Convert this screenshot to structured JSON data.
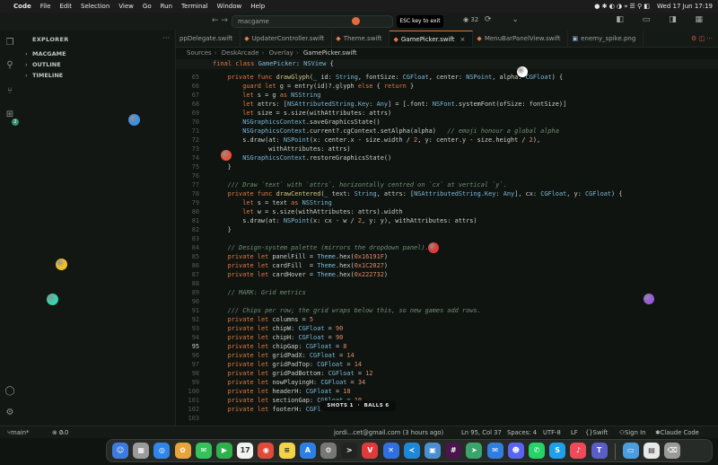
{
  "menubar": {
    "app": "Code",
    "items": [
      "File",
      "Edit",
      "Selection",
      "View",
      "Go",
      "Run",
      "Terminal",
      "Window",
      "Help"
    ],
    "clock": "Wed 17 Jun  17:19"
  },
  "titlebar": {
    "search": "macgame",
    "esc_hint": "ESC key to exit",
    "count": "32"
  },
  "sidebar": {
    "title": "EXPLORER",
    "sections": [
      "MACGAME",
      "OUTLINE",
      "TIMELINE"
    ]
  },
  "activity": {
    "badge": "2"
  },
  "tabs": [
    {
      "label": "ppDelegate.swift",
      "kind": "swift",
      "active": false
    },
    {
      "label": "UpdaterController.swift",
      "kind": "swift",
      "active": false
    },
    {
      "label": "Theme.swift",
      "kind": "swift",
      "active": false
    },
    {
      "label": "GamePicker.swift",
      "kind": "swift",
      "active": true
    },
    {
      "label": "MenuBarPanelView.swift",
      "kind": "swift",
      "active": false
    },
    {
      "label": "enemy_spike.png",
      "kind": "png",
      "active": false
    }
  ],
  "breadcrumb": [
    "Sources",
    "DeskArcade",
    "Overlay",
    "GamePicker.swift"
  ],
  "sticky": {
    "num": "18",
    "text": "final class GamePicker: NSView {"
  },
  "code_lines": [
    {
      "n": "65",
      "html": "    <span class='kw'>private func</span> <span class='fn'>drawGlyph</span>(_ id: <span class='ty'>String</span>, fontSize: <span class='ty'>CGFloat</span>, center: <span class='ty'>NSPoint</span>, alpha: <span class='ty'>CGFloat</span>) {"
    },
    {
      "n": "66",
      "html": "        <span class='kw'>guard let</span> g = entry(id)?.glyph <span class='kw'>else</span> { <span class='kw'>return</span> }"
    },
    {
      "n": "67",
      "html": "        <span class='kw'>let</span> s = g <span class='kw'>as</span> <span class='ty'>NSString</span>"
    },
    {
      "n": "68",
      "html": "        <span class='kw'>let</span> attrs: [<span class='ty'>NSAttributedString.Key</span>: <span class='ty'>Any</span>] = [.font: <span class='ty'>NSFont</span>.systemFont(ofSize: fontSize)]"
    },
    {
      "n": "69",
      "html": "        <span class='kw'>let</span> size = s.size(withAttributes: attrs)"
    },
    {
      "n": "70",
      "html": "        <span class='ty'>NSGraphicsContext</span>.saveGraphicsState()"
    },
    {
      "n": "71",
      "html": "        <span class='ty'>NSGraphicsContext</span>.current?.cgContext.setAlpha(alpha)   <span class='cm'>// emoji honour a global alpha</span>"
    },
    {
      "n": "72",
      "html": "        s.draw(at: <span class='ty'>NSPoint</span>(x: center.x - size.width / <span class='nm'>2</span>, y: center.y - size.height / <span class='nm'>2</span>),"
    },
    {
      "n": "73",
      "html": "               withAttributes: attrs)"
    },
    {
      "n": "74",
      "html": "        <span class='ty'>NSGraphicsContext</span>.restoreGraphicsState()"
    },
    {
      "n": "75",
      "html": "    }"
    },
    {
      "n": "76",
      "html": ""
    },
    {
      "n": "77",
      "html": "    <span class='cm'>/// Draw `text` with `attrs`, horizontally centred on `cx` at vertical `y`.</span>"
    },
    {
      "n": "78",
      "html": "    <span class='kw'>private func</span> <span class='fn'>drawCentered</span>(_ text: <span class='ty'>String</span>, attrs: [<span class='ty'>NSAttributedString.Key</span>: <span class='ty'>Any</span>], cx: <span class='ty'>CGFloat</span>, y: <span class='ty'>CGFloat</span>) {"
    },
    {
      "n": "79",
      "html": "        <span class='kw'>let</span> s = text <span class='kw'>as</span> <span class='ty'>NSString</span>"
    },
    {
      "n": "80",
      "html": "        <span class='kw'>let</span> w = s.size(withAttributes: attrs).width"
    },
    {
      "n": "81",
      "html": "        s.draw(at: <span class='ty'>NSPoint</span>(x: cx - w / <span class='nm'>2</span>, y: y), withAttributes: attrs)"
    },
    {
      "n": "82",
      "html": "    }"
    },
    {
      "n": "83",
      "html": ""
    },
    {
      "n": "84",
      "html": "    <span class='cm'>// Design-system palette (mirrors the dropdown panel).</span>"
    },
    {
      "n": "85",
      "html": "    <span class='kw'>private let</span> panelFill = <span class='ty'>Theme</span>.hex(<span class='nm'>0x16191F</span>)"
    },
    {
      "n": "86",
      "html": "    <span class='kw'>private let</span> cardFill  = <span class='ty'>Theme</span>.hex(<span class='nm'>0x1C2027</span>)"
    },
    {
      "n": "87",
      "html": "    <span class='kw'>private let</span> cardHover = <span class='ty'>Theme</span>.hex(<span class='nm'>0x222732</span>)"
    },
    {
      "n": "88",
      "html": ""
    },
    {
      "n": "89",
      "html": "    <span class='cm'>// MARK: Grid metrics</span>"
    },
    {
      "n": "90",
      "html": ""
    },
    {
      "n": "91",
      "html": "    <span class='cm'>/// Chips per row; the grid wraps below this, so new games add rows.</span>"
    },
    {
      "n": "92",
      "html": "    <span class='kw'>private let</span> columns = <span class='nm'>5</span>"
    },
    {
      "n": "93",
      "html": "    <span class='kw'>private let</span> chipW: <span class='ty'>CGFloat</span> = <span class='nm'>90</span>"
    },
    {
      "n": "94",
      "html": "    <span class='kw'>private let</span> chipH: <span class='ty'>CGFloat</span> = <span class='nm'>90</span>"
    },
    {
      "n": "95",
      "html": "    <span class='kw'>private let</span> chipGap: <span class='ty'>CGFloat</span> = <span class='nm'>8</span>",
      "cur": true
    },
    {
      "n": "96",
      "html": "    <span class='kw'>private let</span> gridPadX: <span class='ty'>CGFloat</span> = <span class='nm'>14</span>"
    },
    {
      "n": "97",
      "html": "    <span class='kw'>private let</span> gridPadTop: <span class='ty'>CGFloat</span> = <span class='nm'>14</span>"
    },
    {
      "n": "98",
      "html": "    <span class='kw'>private let</span> gridPadBottom: <span class='ty'>CGFloat</span> = <span class='nm'>12</span>"
    },
    {
      "n": "99",
      "html": "    <span class='kw'>private let</span> nowPlayingH: <span class='ty'>CGFloat</span> = <span class='nm'>34</span>"
    },
    {
      "n": "100",
      "html": "    <span class='kw'>private let</span> headerH: <span class='ty'>CGFloat</span> = <span class='nm'>18</span>"
    },
    {
      "n": "101",
      "html": "    <span class='kw'>private let</span> sectionGap: <span class='ty'>CGFloat</span> = <span class='nm'>10</span>"
    },
    {
      "n": "102",
      "html": "    <span class='kw'>private let</span> footerH: <span class='ty'>CGFloat</span> = <span class='nm'>22</span>"
    },
    {
      "n": "103",
      "html": ""
    }
  ],
  "hud": {
    "shots_label": "SHOTS",
    "shots": "1",
    "balls_label": "BALLS",
    "balls": "6"
  },
  "balls": [
    {
      "color": "#ffffff",
      "name": "white-ball"
    },
    {
      "color": "#3f8fe0",
      "name": "blue-ball"
    },
    {
      "color": "#e8553a",
      "name": "orange-ball"
    },
    {
      "color": "#e23a3a",
      "name": "red-ball"
    },
    {
      "color": "#f0c02a",
      "name": "yellow-ball"
    },
    {
      "color": "#3ad0b0",
      "name": "teal-ball"
    },
    {
      "color": "#9a5ae0",
      "name": "purple-ball"
    }
  ],
  "statusbar": {
    "branch": "main*",
    "errors": "0",
    "warnings": "0",
    "blame": "jordi...cet@gmail.com (3 hours ago)",
    "position": "Ln 95, Col 37",
    "spaces": "Spaces: 4",
    "encoding": "UTF-8",
    "eol": "LF",
    "lang": "Swift",
    "signin": "Sign In",
    "claude": "Claude Code"
  },
  "dock": [
    {
      "name": "finder-icon",
      "color": "#3d7be0",
      "glyph": "☺"
    },
    {
      "name": "launchpad-icon",
      "color": "#9b9b9b",
      "glyph": "▦"
    },
    {
      "name": "safari-icon",
      "color": "#2f86e8",
      "glyph": "◎"
    },
    {
      "name": "photos-icon",
      "color": "#e8a33a",
      "glyph": "✿"
    },
    {
      "name": "messages-icon",
      "color": "#33c35a",
      "glyph": "✉"
    },
    {
      "name": "facetime-icon",
      "color": "#2fb04c",
      "glyph": "▶"
    },
    {
      "name": "calendar-icon",
      "color": "#f2f2f2",
      "glyph": "17"
    },
    {
      "name": "chrome-icon",
      "color": "#e04a3a",
      "glyph": "◉"
    },
    {
      "name": "notes-icon",
      "color": "#f2d34a",
      "glyph": "≡"
    },
    {
      "name": "appstore-icon",
      "color": "#2d7fe6",
      "glyph": "A"
    },
    {
      "name": "settings-icon",
      "color": "#777",
      "glyph": "⚙"
    },
    {
      "name": "terminal-icon",
      "color": "#222",
      "glyph": ">"
    },
    {
      "name": "vivaldi-icon",
      "color": "#e03a3a",
      "glyph": "V"
    },
    {
      "name": "xcode-icon",
      "color": "#2f6fe0",
      "glyph": "✕"
    },
    {
      "name": "vscode-icon",
      "color": "#1e88d8",
      "glyph": "≺"
    },
    {
      "name": "preview-icon",
      "color": "#4a90d0",
      "glyph": "▣"
    },
    {
      "name": "slack-icon",
      "color": "#4a154b",
      "glyph": "#"
    },
    {
      "name": "maps-icon",
      "color": "#3aa56a",
      "glyph": "➤"
    },
    {
      "name": "mail-icon",
      "color": "#2f7ee0",
      "glyph": "✉"
    },
    {
      "name": "discord-icon",
      "color": "#5865f2",
      "glyph": "☻"
    },
    {
      "name": "whatsapp-icon",
      "color": "#25d366",
      "glyph": "✆"
    },
    {
      "name": "skype-icon",
      "color": "#1fa0e8",
      "glyph": "S"
    },
    {
      "name": "music-icon",
      "color": "#f04a5a",
      "glyph": "♪"
    },
    {
      "name": "teams-icon",
      "color": "#5a5fc8",
      "glyph": "T"
    },
    {
      "name": "folder-icon",
      "color": "#4a9ee0",
      "glyph": "▭"
    },
    {
      "name": "document-icon",
      "color": "#e8e8e8",
      "glyph": "▤"
    },
    {
      "name": "trash-icon",
      "color": "#9a9a9a",
      "glyph": "⌫"
    }
  ]
}
